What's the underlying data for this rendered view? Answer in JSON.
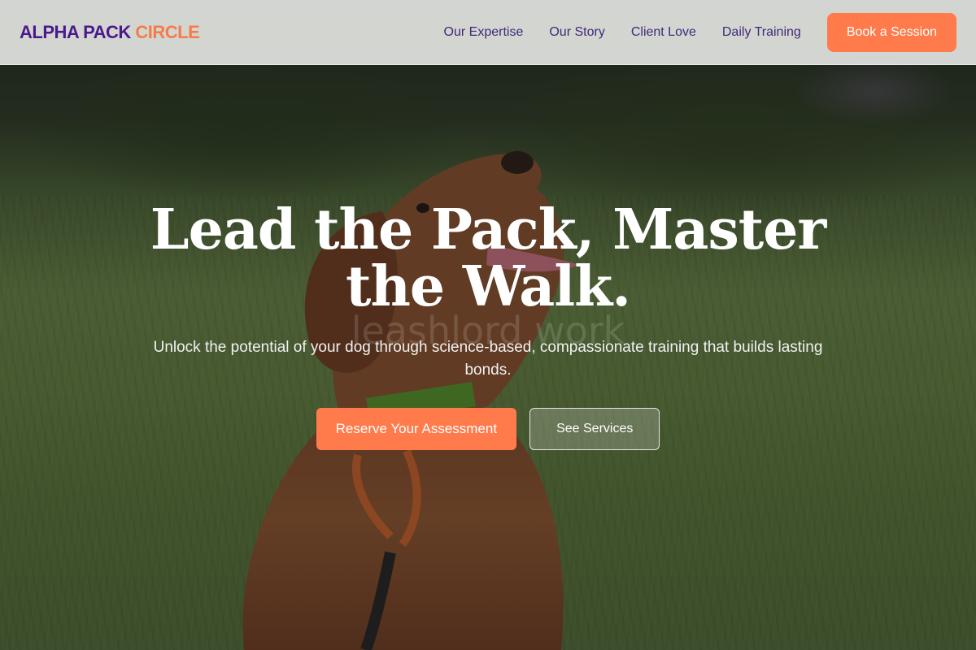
{
  "nav": {
    "logo_part1": "ALPHA PACK",
    "logo_part2": "CIRCLE",
    "links": [
      "Our Expertise",
      "Our Story",
      "Client Love",
      "Daily Training"
    ],
    "book_label": "Book a Session"
  },
  "hero": {
    "background_text": "leashlord work",
    "headline": "Lead the Pack, Master the Walk.",
    "subheadline": "Unlock the potential of your dog through science-based, compassionate training that builds lasting bonds.",
    "primary_cta": "Reserve Your Assessment",
    "secondary_cta": "See Services"
  },
  "colors": {
    "brand_purple": "#4a1a8c",
    "accent_orange": "#ff7b4c",
    "nav_link": "#3f2a7a"
  }
}
